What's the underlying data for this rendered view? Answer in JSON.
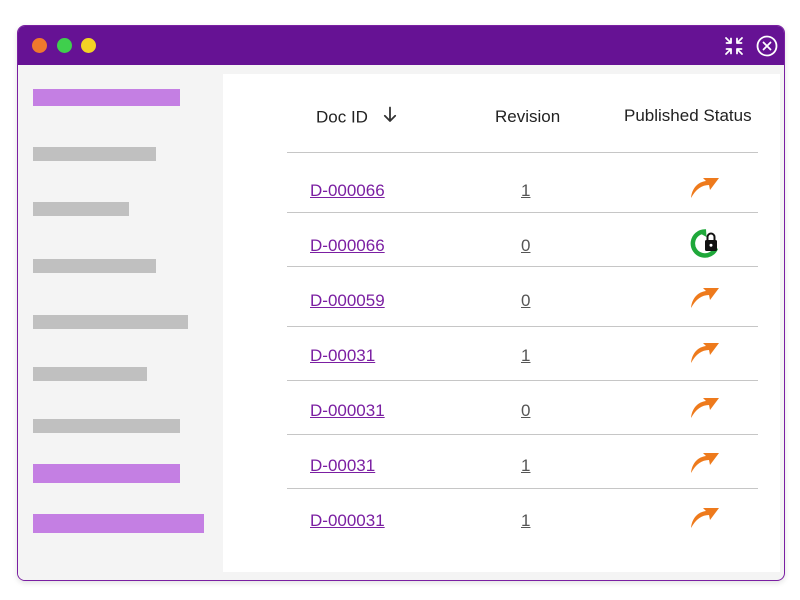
{
  "window": {
    "controls": {
      "red": "#f0782d",
      "green": "#3fcf4d",
      "yellow": "#f3d324"
    },
    "title_bar_color": "#661294",
    "accent_color": "#7b1fa2",
    "title_icons": [
      "compress-icon",
      "close-icon"
    ]
  },
  "sidebar": {
    "highlight_color": "#c47fe3",
    "placeholder_color": "#c0c0c0",
    "items": [
      {
        "state": "active"
      },
      {
        "state": "placeholder"
      },
      {
        "state": "placeholder"
      },
      {
        "state": "placeholder"
      },
      {
        "state": "placeholder"
      },
      {
        "state": "placeholder"
      },
      {
        "state": "placeholder"
      },
      {
        "state": "active"
      },
      {
        "state": "active"
      }
    ]
  },
  "table": {
    "columns": {
      "doc_id": "Doc ID",
      "revision": "Revision",
      "published_status": "Published Status"
    },
    "sort": {
      "column": "doc_id",
      "direction": "descending",
      "icon": "arrow-down-icon"
    },
    "rows": [
      {
        "doc_id": "D-000066",
        "revision": "1",
        "status": "published",
        "status_icon": "published-share-icon"
      },
      {
        "doc_id": "D-000066",
        "revision": "0",
        "status": "locked",
        "status_icon": "sync-locked-icon"
      },
      {
        "doc_id": "D-000059",
        "revision": "0",
        "status": "published",
        "status_icon": "published-share-icon"
      },
      {
        "doc_id": "D-00031",
        "revision": "1",
        "status": "published",
        "status_icon": "published-share-icon"
      },
      {
        "doc_id": "D-000031",
        "revision": "0",
        "status": "published",
        "status_icon": "published-share-icon"
      },
      {
        "doc_id": "D-00031",
        "revision": "1",
        "status": "published",
        "status_icon": "published-share-icon"
      },
      {
        "doc_id": "D-000031",
        "revision": "1",
        "status": "published",
        "status_icon": "published-share-icon"
      }
    ],
    "status_colors": {
      "published": "#ee7a1c",
      "locked": "#1fa83a"
    }
  }
}
